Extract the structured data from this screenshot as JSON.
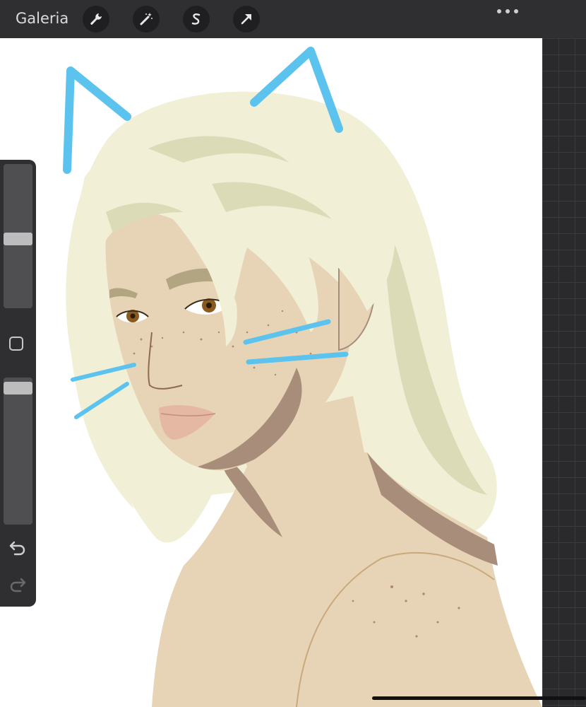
{
  "topbar": {
    "gallery_label": "Galeria",
    "tools": [
      {
        "name": "wrench-icon"
      },
      {
        "name": "magic-wand-icon"
      },
      {
        "name": "selection-s-icon"
      },
      {
        "name": "transform-arrow-icon"
      }
    ],
    "more_icon": "more-dots-icon"
  },
  "sidebar": {
    "brush_size_level": 0.48,
    "opacity_level": 0.03,
    "modify_icon": "square-icon",
    "undo_icon": "undo-icon",
    "redo_icon": "redo-icon"
  },
  "colors": {
    "hair": "#f1f0d6",
    "hair_shadow": "#dcdbb7",
    "skin": "#e7d4b6",
    "skin_shadow": "#a88d7a",
    "lips": "#e4b8a2",
    "eyes": "#8a5a1e",
    "cat_lines": "#5bc3ee",
    "toolbar": "#2f2f31"
  }
}
